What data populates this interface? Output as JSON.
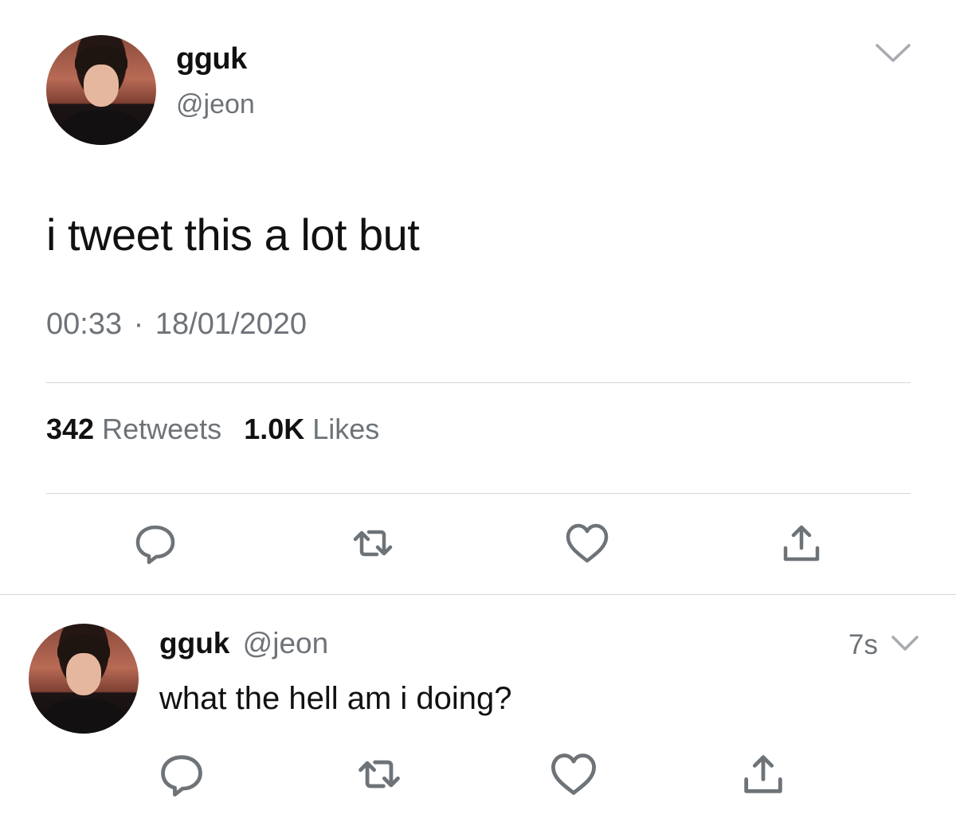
{
  "main_tweet": {
    "display_name": "gguk",
    "handle": "@jeon",
    "text": "i tweet this a lot but",
    "time": "00:33",
    "separator": "·",
    "date": "18/01/2020",
    "retweets_count": "342",
    "retweets_label": "Retweets",
    "likes_count": "1.0K",
    "likes_label": "Likes"
  },
  "reply_tweet": {
    "display_name": "gguk",
    "handle": "@jeon",
    "time_ago": "7s",
    "text": "what the hell am i doing?"
  },
  "icons": {
    "reply": "reply-icon",
    "retweet": "retweet-icon",
    "like": "heart-icon",
    "share": "share-icon",
    "menu": "chevron-down-icon"
  },
  "colors": {
    "text_primary": "#111111",
    "text_secondary": "#6e7378",
    "icon": "#6e7378",
    "divider": "#d4d7da"
  }
}
